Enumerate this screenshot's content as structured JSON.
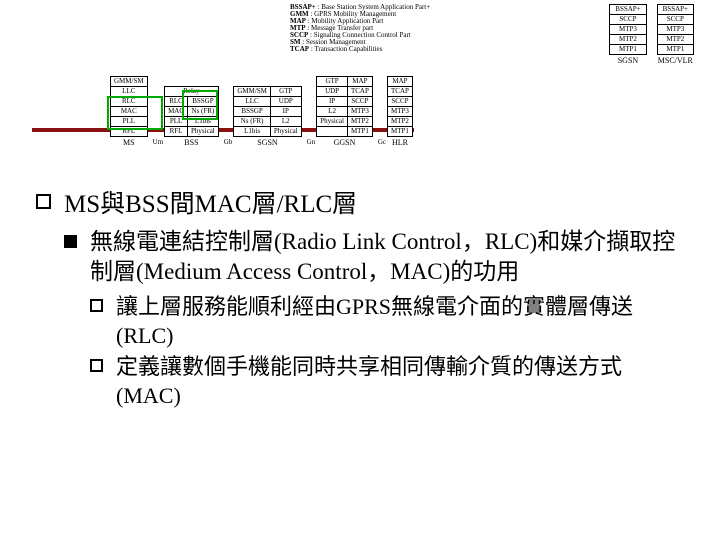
{
  "legend": [
    {
      "k": "BSSAP+",
      "v": "Base Station System Application Part+"
    },
    {
      "k": "GMM",
      "v": "GPRS Mobility Management"
    },
    {
      "k": "MAP",
      "v": "Mobility Application Part"
    },
    {
      "k": "MTP",
      "v": "Message Transfer part"
    },
    {
      "k": "SCCP",
      "v": "Signaling Connection Control Part"
    },
    {
      "k": "SM",
      "v": "Session Management"
    },
    {
      "k": "TCAP",
      "v": "Transaction Capabilities"
    }
  ],
  "top_right": {
    "sgsn": {
      "label": "SGSN",
      "rows": [
        [
          "BSSAP+"
        ],
        [
          "SCCP"
        ],
        [
          "MTP3"
        ],
        [
          "MTP2"
        ],
        [
          "MTP1"
        ]
      ]
    },
    "mscvlr": {
      "label": "MSC/VLR",
      "rows": [
        [
          "BSSAP+"
        ],
        [
          "SCCP"
        ],
        [
          "MTP3"
        ],
        [
          "MTP2"
        ],
        [
          "MTP1"
        ]
      ]
    }
  },
  "stacks": {
    "ms": {
      "label": "MS",
      "rows": [
        [
          "GMM/SM"
        ],
        [
          "LLC"
        ],
        [
          "RLC"
        ],
        [
          "MAC"
        ],
        [
          "PLL"
        ],
        [
          "RFL"
        ]
      ]
    },
    "bss": {
      "label": "BSS",
      "rows": [
        [
          "RLC",
          "BSSGP"
        ],
        [
          "MAC",
          "Ns (FR)"
        ],
        [
          "PLL",
          "L1bis"
        ],
        [
          "RFL",
          "Physical"
        ]
      ],
      "top": "Relay"
    },
    "sgsn": {
      "label": "SGSN",
      "rows": [
        [
          "GMM/SM",
          "GTP"
        ],
        [
          "LLC",
          "UDP"
        ],
        [
          "BSSGP",
          "IP"
        ],
        [
          "Ns (FR)",
          "L2"
        ],
        [
          "L1bis",
          "Physical"
        ]
      ]
    },
    "ggsn": {
      "label": "GGSN",
      "rows": [
        [
          "GTP",
          "MAP"
        ],
        [
          "UDP",
          "TCAP"
        ],
        [
          "IP",
          "SCCP"
        ],
        [
          "L2",
          "MTP3"
        ],
        [
          "Physical",
          "MTP2"
        ],
        [
          "",
          "MTP1"
        ]
      ]
    },
    "hlr": {
      "label": "HLR",
      "rows": [
        [
          "MAP"
        ],
        [
          "TCAP"
        ],
        [
          "SCCP"
        ],
        [
          "MTP3"
        ],
        [
          "MTP2"
        ],
        [
          "MTP1"
        ]
      ]
    }
  },
  "ifaces": [
    "Um",
    "Gb",
    "Gn",
    "Gc"
  ],
  "bullets": {
    "l1": "MS與BSS間MAC層/RLC層",
    "l2": "無線電連結控制層(Radio Link Control，RLC)和媒介擷取控制層(Medium Access Control，MAC)的功用",
    "l3a": "讓上層服務能順利經由GPRS無線電介面的實體層傳送(RLC)",
    "l3b": "定義讓數個手機能同時共享相同傳輸介質的傳送方式(MAC)"
  }
}
